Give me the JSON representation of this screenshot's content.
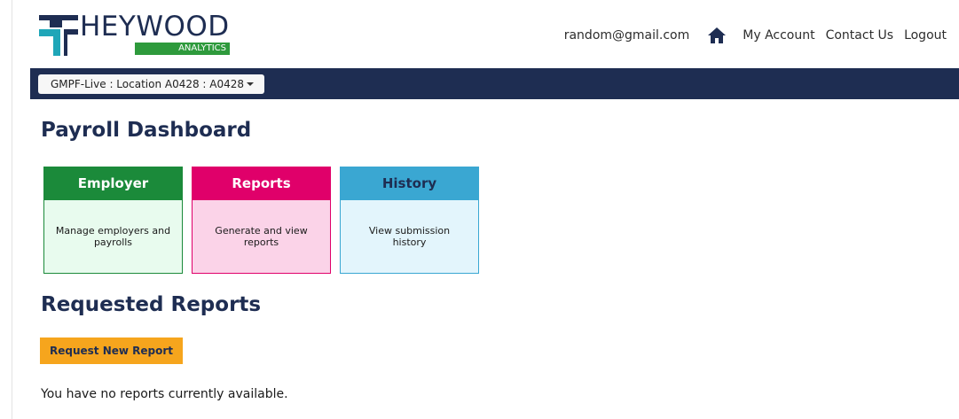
{
  "brand": {
    "name": "HEYWOOD",
    "sub": "ANALYTICS",
    "colors": {
      "navy": "#1e2d52",
      "green": "#2e9a3c",
      "teal": "#1fa6b8"
    }
  },
  "top_nav": {
    "email": "random@gmail.com",
    "home_icon": "home-icon",
    "my_account": "My Account",
    "contact_us": "Contact Us",
    "logout": "Logout"
  },
  "location_bar": {
    "selected": "GMPF-Live : Location A0428 : A0428"
  },
  "dashboard": {
    "title": "Payroll Dashboard",
    "tiles": [
      {
        "title": "Employer",
        "description": "Manage employers and payrolls",
        "color": "#1b8a3a"
      },
      {
        "title": "Reports",
        "description": "Generate and view reports",
        "color": "#e0006a"
      },
      {
        "title": "History",
        "description": "View submission history",
        "color": "#3aa7d2"
      }
    ]
  },
  "requested_reports": {
    "title": "Requested Reports",
    "button_label": "Request New Report",
    "button_color": "#f6a51d",
    "empty_message": "You have no reports currently available."
  }
}
